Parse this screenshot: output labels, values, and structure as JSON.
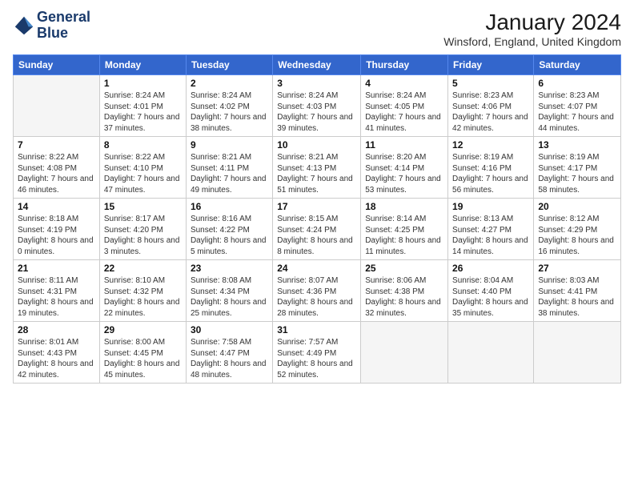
{
  "logo": {
    "text_line1": "General",
    "text_line2": "Blue"
  },
  "title": "January 2024",
  "subtitle": "Winsford, England, United Kingdom",
  "headers": [
    "Sunday",
    "Monday",
    "Tuesday",
    "Wednesday",
    "Thursday",
    "Friday",
    "Saturday"
  ],
  "weeks": [
    [
      {
        "day": "",
        "sunrise": "",
        "sunset": "",
        "daylight": "",
        "empty": true
      },
      {
        "day": "1",
        "sunrise": "Sunrise: 8:24 AM",
        "sunset": "Sunset: 4:01 PM",
        "daylight": "Daylight: 7 hours and 37 minutes."
      },
      {
        "day": "2",
        "sunrise": "Sunrise: 8:24 AM",
        "sunset": "Sunset: 4:02 PM",
        "daylight": "Daylight: 7 hours and 38 minutes."
      },
      {
        "day": "3",
        "sunrise": "Sunrise: 8:24 AM",
        "sunset": "Sunset: 4:03 PM",
        "daylight": "Daylight: 7 hours and 39 minutes."
      },
      {
        "day": "4",
        "sunrise": "Sunrise: 8:24 AM",
        "sunset": "Sunset: 4:05 PM",
        "daylight": "Daylight: 7 hours and 41 minutes."
      },
      {
        "day": "5",
        "sunrise": "Sunrise: 8:23 AM",
        "sunset": "Sunset: 4:06 PM",
        "daylight": "Daylight: 7 hours and 42 minutes."
      },
      {
        "day": "6",
        "sunrise": "Sunrise: 8:23 AM",
        "sunset": "Sunset: 4:07 PM",
        "daylight": "Daylight: 7 hours and 44 minutes."
      }
    ],
    [
      {
        "day": "7",
        "sunrise": "Sunrise: 8:22 AM",
        "sunset": "Sunset: 4:08 PM",
        "daylight": "Daylight: 7 hours and 46 minutes."
      },
      {
        "day": "8",
        "sunrise": "Sunrise: 8:22 AM",
        "sunset": "Sunset: 4:10 PM",
        "daylight": "Daylight: 7 hours and 47 minutes."
      },
      {
        "day": "9",
        "sunrise": "Sunrise: 8:21 AM",
        "sunset": "Sunset: 4:11 PM",
        "daylight": "Daylight: 7 hours and 49 minutes."
      },
      {
        "day": "10",
        "sunrise": "Sunrise: 8:21 AM",
        "sunset": "Sunset: 4:13 PM",
        "daylight": "Daylight: 7 hours and 51 minutes."
      },
      {
        "day": "11",
        "sunrise": "Sunrise: 8:20 AM",
        "sunset": "Sunset: 4:14 PM",
        "daylight": "Daylight: 7 hours and 53 minutes."
      },
      {
        "day": "12",
        "sunrise": "Sunrise: 8:19 AM",
        "sunset": "Sunset: 4:16 PM",
        "daylight": "Daylight: 7 hours and 56 minutes."
      },
      {
        "day": "13",
        "sunrise": "Sunrise: 8:19 AM",
        "sunset": "Sunset: 4:17 PM",
        "daylight": "Daylight: 7 hours and 58 minutes."
      }
    ],
    [
      {
        "day": "14",
        "sunrise": "Sunrise: 8:18 AM",
        "sunset": "Sunset: 4:19 PM",
        "daylight": "Daylight: 8 hours and 0 minutes."
      },
      {
        "day": "15",
        "sunrise": "Sunrise: 8:17 AM",
        "sunset": "Sunset: 4:20 PM",
        "daylight": "Daylight: 8 hours and 3 minutes."
      },
      {
        "day": "16",
        "sunrise": "Sunrise: 8:16 AM",
        "sunset": "Sunset: 4:22 PM",
        "daylight": "Daylight: 8 hours and 5 minutes."
      },
      {
        "day": "17",
        "sunrise": "Sunrise: 8:15 AM",
        "sunset": "Sunset: 4:24 PM",
        "daylight": "Daylight: 8 hours and 8 minutes."
      },
      {
        "day": "18",
        "sunrise": "Sunrise: 8:14 AM",
        "sunset": "Sunset: 4:25 PM",
        "daylight": "Daylight: 8 hours and 11 minutes."
      },
      {
        "day": "19",
        "sunrise": "Sunrise: 8:13 AM",
        "sunset": "Sunset: 4:27 PM",
        "daylight": "Daylight: 8 hours and 14 minutes."
      },
      {
        "day": "20",
        "sunrise": "Sunrise: 8:12 AM",
        "sunset": "Sunset: 4:29 PM",
        "daylight": "Daylight: 8 hours and 16 minutes."
      }
    ],
    [
      {
        "day": "21",
        "sunrise": "Sunrise: 8:11 AM",
        "sunset": "Sunset: 4:31 PM",
        "daylight": "Daylight: 8 hours and 19 minutes."
      },
      {
        "day": "22",
        "sunrise": "Sunrise: 8:10 AM",
        "sunset": "Sunset: 4:32 PM",
        "daylight": "Daylight: 8 hours and 22 minutes."
      },
      {
        "day": "23",
        "sunrise": "Sunrise: 8:08 AM",
        "sunset": "Sunset: 4:34 PM",
        "daylight": "Daylight: 8 hours and 25 minutes."
      },
      {
        "day": "24",
        "sunrise": "Sunrise: 8:07 AM",
        "sunset": "Sunset: 4:36 PM",
        "daylight": "Daylight: 8 hours and 28 minutes."
      },
      {
        "day": "25",
        "sunrise": "Sunrise: 8:06 AM",
        "sunset": "Sunset: 4:38 PM",
        "daylight": "Daylight: 8 hours and 32 minutes."
      },
      {
        "day": "26",
        "sunrise": "Sunrise: 8:04 AM",
        "sunset": "Sunset: 4:40 PM",
        "daylight": "Daylight: 8 hours and 35 minutes."
      },
      {
        "day": "27",
        "sunrise": "Sunrise: 8:03 AM",
        "sunset": "Sunset: 4:41 PM",
        "daylight": "Daylight: 8 hours and 38 minutes."
      }
    ],
    [
      {
        "day": "28",
        "sunrise": "Sunrise: 8:01 AM",
        "sunset": "Sunset: 4:43 PM",
        "daylight": "Daylight: 8 hours and 42 minutes."
      },
      {
        "day": "29",
        "sunrise": "Sunrise: 8:00 AM",
        "sunset": "Sunset: 4:45 PM",
        "daylight": "Daylight: 8 hours and 45 minutes."
      },
      {
        "day": "30",
        "sunrise": "Sunrise: 7:58 AM",
        "sunset": "Sunset: 4:47 PM",
        "daylight": "Daylight: 8 hours and 48 minutes."
      },
      {
        "day": "31",
        "sunrise": "Sunrise: 7:57 AM",
        "sunset": "Sunset: 4:49 PM",
        "daylight": "Daylight: 8 hours and 52 minutes."
      },
      {
        "day": "",
        "sunrise": "",
        "sunset": "",
        "daylight": "",
        "empty": true
      },
      {
        "day": "",
        "sunrise": "",
        "sunset": "",
        "daylight": "",
        "empty": true
      },
      {
        "day": "",
        "sunrise": "",
        "sunset": "",
        "daylight": "",
        "empty": true
      }
    ]
  ]
}
